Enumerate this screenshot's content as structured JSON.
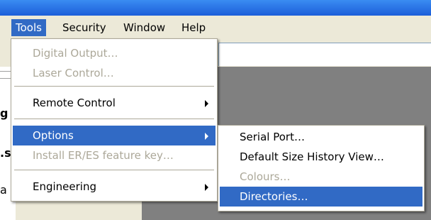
{
  "menubar": {
    "items": [
      {
        "label": "Tools"
      },
      {
        "label": "Security"
      },
      {
        "label": "Window"
      },
      {
        "label": "Help"
      }
    ]
  },
  "background": {
    "frag1": "g",
    "frag2": ".s",
    "frag3": "a"
  },
  "tools_menu": {
    "items": [
      {
        "label": "Digital Output…"
      },
      {
        "label": "Laser Control…"
      },
      {
        "label": "Remote Control"
      },
      {
        "label": "Options"
      },
      {
        "label": "Install ER/ES feature key…"
      },
      {
        "label": "Engineering"
      }
    ]
  },
  "options_menu": {
    "items": [
      {
        "label": "Serial Port…"
      },
      {
        "label": "Default Size History View…"
      },
      {
        "label": "Colours…"
      },
      {
        "label": "Directories…"
      }
    ]
  },
  "colors": {
    "highlight": "#316ac5",
    "disabled": "#aca899",
    "menubar_bg": "#ece9d8",
    "titlebar": "#1c5ed9"
  }
}
